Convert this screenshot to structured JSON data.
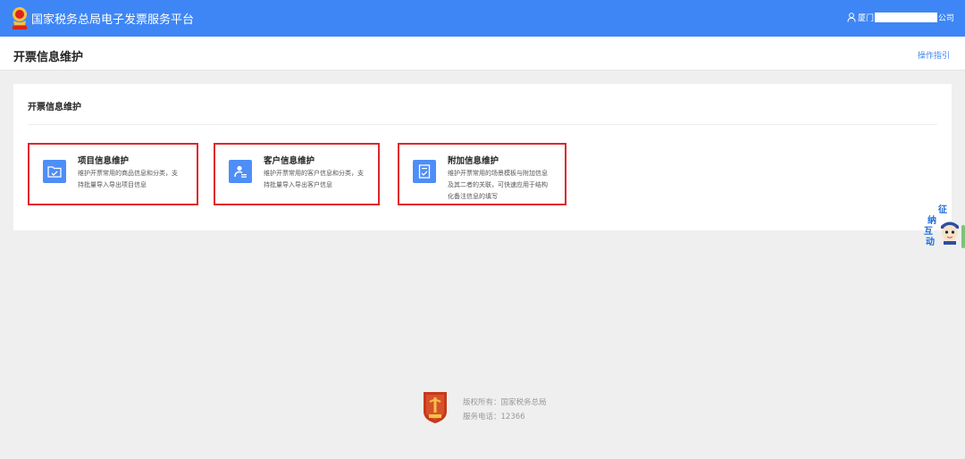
{
  "header": {
    "app_title": "国家税务总局电子发票服务平台",
    "user_prefix": "厦门",
    "user_suffix": "公司"
  },
  "pagebar": {
    "title": "开票信息维护",
    "guide_label": "操作指引"
  },
  "main": {
    "section_title": "开票信息维护",
    "cards": [
      {
        "title": "项目信息维护",
        "desc_line1": "维护开票常用的商品信息和分类，支",
        "desc_line2": "持批量导入导出项目信息",
        "desc_line3": "",
        "icon": "folder-icon"
      },
      {
        "title": "客户信息维护",
        "desc_line1": "维护开票常用的客户信息和分类，支",
        "desc_line2": "持批量导入导出客户信息",
        "desc_line3": "",
        "icon": "contact-card-icon"
      },
      {
        "title": "附加信息维护",
        "desc_line1": "维护开票常用的场景模板与附加信息",
        "desc_line2": "及其二者的关联，可快速应用于结构",
        "desc_line3": "化备注信息的填写",
        "icon": "document-edit-icon"
      }
    ]
  },
  "float_widget": {
    "chars": [
      "征",
      "纳",
      "互",
      "动"
    ]
  },
  "footer": {
    "copyright": "版权所有：国家税务总局",
    "hotline": "服务电话：12366"
  },
  "colors": {
    "brand_blue": "#3e86f5",
    "highlight_red": "#e0262b",
    "icon_blue": "#4e8ef7"
  }
}
